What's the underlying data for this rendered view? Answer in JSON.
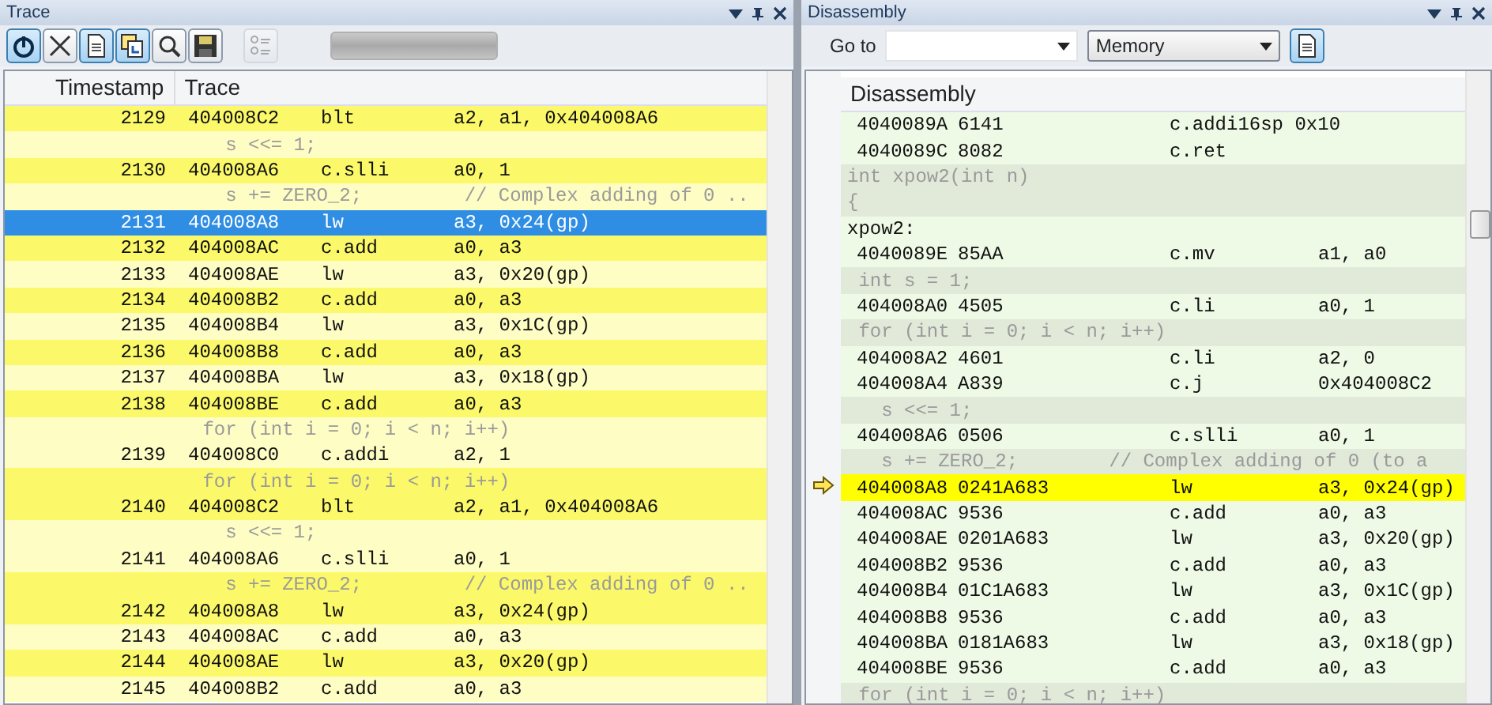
{
  "trace_panel": {
    "title": "Trace",
    "toolbar": [
      {
        "kind": "power",
        "pressed": true,
        "disabled": false
      },
      {
        "kind": "clear",
        "pressed": false,
        "disabled": false
      },
      {
        "kind": "document",
        "pressed": true,
        "disabled": false
      },
      {
        "kind": "document-link",
        "pressed": true,
        "disabled": false
      },
      {
        "kind": "find",
        "pressed": false,
        "disabled": false
      },
      {
        "kind": "save",
        "pressed": false,
        "disabled": false
      },
      {
        "kind": "list",
        "pressed": false,
        "disabled": true
      }
    ],
    "columns": [
      "Timestamp",
      "Trace"
    ],
    "rows": [
      {
        "kind": "instruction",
        "band": true,
        "selected": false,
        "timestamp": "2129",
        "address": "404008C2",
        "mnemonic": "blt",
        "operands": "a2, a1, 0x404008A6"
      },
      {
        "kind": "source",
        "band": false,
        "selected": false,
        "text": "   s <<= 1;"
      },
      {
        "kind": "instruction",
        "band": true,
        "selected": false,
        "timestamp": "2130",
        "address": "404008A6",
        "mnemonic": "c.slli",
        "operands": "a0, 1"
      },
      {
        "kind": "source",
        "band": false,
        "selected": false,
        "text": "   s += ZERO_2;         // Complex adding of 0 .."
      },
      {
        "kind": "instruction",
        "selected": true,
        "timestamp": "2131",
        "address": "404008A8",
        "mnemonic": "lw",
        "operands": "a3, 0x24(gp)"
      },
      {
        "kind": "instruction",
        "band": true,
        "selected": false,
        "timestamp": "2132",
        "address": "404008AC",
        "mnemonic": "c.add",
        "operands": "a0, a3"
      },
      {
        "kind": "instruction",
        "band": false,
        "selected": false,
        "timestamp": "2133",
        "address": "404008AE",
        "mnemonic": "lw",
        "operands": "a3, 0x20(gp)"
      },
      {
        "kind": "instruction",
        "band": true,
        "selected": false,
        "timestamp": "2134",
        "address": "404008B2",
        "mnemonic": "c.add",
        "operands": "a0, a3"
      },
      {
        "kind": "instruction",
        "band": false,
        "selected": false,
        "timestamp": "2135",
        "address": "404008B4",
        "mnemonic": "lw",
        "operands": "a3, 0x1C(gp)"
      },
      {
        "kind": "instruction",
        "band": true,
        "selected": false,
        "timestamp": "2136",
        "address": "404008B8",
        "mnemonic": "c.add",
        "operands": "a0, a3"
      },
      {
        "kind": "instruction",
        "band": false,
        "selected": false,
        "timestamp": "2137",
        "address": "404008BA",
        "mnemonic": "lw",
        "operands": "a3, 0x18(gp)"
      },
      {
        "kind": "instruction",
        "band": true,
        "selected": false,
        "timestamp": "2138",
        "address": "404008BE",
        "mnemonic": "c.add",
        "operands": "a0, a3"
      },
      {
        "kind": "source",
        "band": false,
        "selected": false,
        "text": " for (int i = 0; i < n; i++)"
      },
      {
        "kind": "instruction",
        "band": false,
        "selected": false,
        "timestamp": "2139",
        "address": "404008C0",
        "mnemonic": "c.addi",
        "operands": "a2, 1"
      },
      {
        "kind": "source",
        "band": true,
        "selected": false,
        "text": " for (int i = 0; i < n; i++)"
      },
      {
        "kind": "instruction",
        "band": true,
        "selected": false,
        "timestamp": "2140",
        "address": "404008C2",
        "mnemonic": "blt",
        "operands": "a2, a1, 0x404008A6"
      },
      {
        "kind": "source",
        "band": false,
        "selected": false,
        "text": "   s <<= 1;"
      },
      {
        "kind": "instruction",
        "band": false,
        "selected": false,
        "timestamp": "2141",
        "address": "404008A6",
        "mnemonic": "c.slli",
        "operands": "a0, 1"
      },
      {
        "kind": "source",
        "band": true,
        "selected": false,
        "text": "   s += ZERO_2;         // Complex adding of 0 .."
      },
      {
        "kind": "instruction",
        "band": true,
        "selected": false,
        "timestamp": "2142",
        "address": "404008A8",
        "mnemonic": "lw",
        "operands": "a3, 0x24(gp)"
      },
      {
        "kind": "instruction",
        "band": false,
        "selected": false,
        "timestamp": "2143",
        "address": "404008AC",
        "mnemonic": "c.add",
        "operands": "a0, a3"
      },
      {
        "kind": "instruction",
        "band": true,
        "selected": false,
        "timestamp": "2144",
        "address": "404008AE",
        "mnemonic": "lw",
        "operands": "a3, 0x20(gp)"
      },
      {
        "kind": "instruction",
        "band": false,
        "selected": false,
        "timestamp": "2145",
        "address": "404008B2",
        "mnemonic": "c.add",
        "operands": "a0, a3"
      }
    ]
  },
  "disassembly_panel": {
    "title": "Disassembly",
    "goto_label": "Go to",
    "memory_select": "Memory",
    "column": "Disassembly",
    "rows": [
      {
        "kind": "instruction",
        "current": false,
        "address": "4040089A",
        "opcode": "6141",
        "mnemonic": "c.addi16sp 0x10",
        "operands": ""
      },
      {
        "kind": "instruction",
        "current": false,
        "address": "4040089C",
        "opcode": "8082",
        "mnemonic": "c.ret",
        "operands": ""
      },
      {
        "kind": "source",
        "text": "int xpow2(int n)"
      },
      {
        "kind": "source",
        "text": "{"
      },
      {
        "kind": "label",
        "text": "xpow2:"
      },
      {
        "kind": "instruction",
        "current": false,
        "address": "4040089E",
        "opcode": "85AA",
        "mnemonic": "c.mv",
        "operands": "a1, a0"
      },
      {
        "kind": "source",
        "text": " int s = 1;"
      },
      {
        "kind": "instruction",
        "current": false,
        "address": "404008A0",
        "opcode": "4505",
        "mnemonic": "c.li",
        "operands": "a0, 1"
      },
      {
        "kind": "source",
        "text": " for (int i = 0; i < n; i++)"
      },
      {
        "kind": "instruction",
        "current": false,
        "address": "404008A2",
        "opcode": "4601",
        "mnemonic": "c.li",
        "operands": "a2, 0"
      },
      {
        "kind": "instruction",
        "current": false,
        "address": "404008A4",
        "opcode": "A839",
        "mnemonic": "c.j",
        "operands": "0x404008C2"
      },
      {
        "kind": "source",
        "text": "   s <<= 1;"
      },
      {
        "kind": "instruction",
        "current": false,
        "address": "404008A6",
        "opcode": "0506",
        "mnemonic": "c.slli",
        "operands": "a0, 1"
      },
      {
        "kind": "source",
        "text": "   s += ZERO_2;        // Complex adding of 0 (to a"
      },
      {
        "kind": "instruction",
        "current": true,
        "address": "404008A8",
        "opcode": "0241A683",
        "mnemonic": "lw",
        "operands": "a3, 0x24(gp)"
      },
      {
        "kind": "instruction",
        "current": false,
        "address": "404008AC",
        "opcode": "9536",
        "mnemonic": "c.add",
        "operands": "a0, a3"
      },
      {
        "kind": "instruction",
        "current": false,
        "address": "404008AE",
        "opcode": "0201A683",
        "mnemonic": "lw",
        "operands": "a3, 0x20(gp)"
      },
      {
        "kind": "instruction",
        "current": false,
        "address": "404008B2",
        "opcode": "9536",
        "mnemonic": "c.add",
        "operands": "a0, a3"
      },
      {
        "kind": "instruction",
        "current": false,
        "address": "404008B4",
        "opcode": "01C1A683",
        "mnemonic": "lw",
        "operands": "a3, 0x1C(gp)"
      },
      {
        "kind": "instruction",
        "current": false,
        "address": "404008B8",
        "opcode": "9536",
        "mnemonic": "c.add",
        "operands": "a0, a3"
      },
      {
        "kind": "instruction",
        "current": false,
        "address": "404008BA",
        "opcode": "0181A683",
        "mnemonic": "lw",
        "operands": "a3, 0x18(gp)"
      },
      {
        "kind": "instruction",
        "current": false,
        "address": "404008BE",
        "opcode": "9536",
        "mnemonic": "c.add",
        "operands": "a0, a3"
      },
      {
        "kind": "source",
        "text": " for (int i = 0; i < n; i++)"
      }
    ]
  }
}
